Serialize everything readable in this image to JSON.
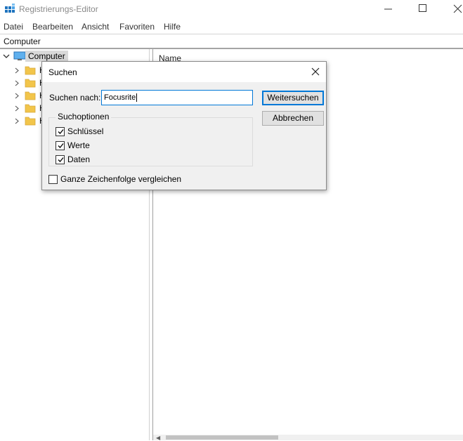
{
  "window": {
    "title": "Registrierungs-Editor",
    "controls": [
      "minimize-icon",
      "maximize-icon",
      "close-icon"
    ]
  },
  "menu": {
    "items": [
      "Datei",
      "Bearbeiten",
      "Ansicht",
      "Favoriten",
      "Hilfe"
    ]
  },
  "address": {
    "path": "Computer"
  },
  "tree": {
    "root_label": "Computer",
    "children": [
      {
        "label": "H",
        "icon": "folder-icon"
      },
      {
        "label": "H",
        "icon": "folder-icon"
      },
      {
        "label": "H",
        "icon": "folder-icon"
      },
      {
        "label": "H",
        "icon": "folder-icon"
      },
      {
        "label": "H",
        "icon": "folder-icon"
      }
    ]
  },
  "list": {
    "column_name": "Name"
  },
  "dialog": {
    "title": "Suchen",
    "find_label": "Suchen nach:",
    "find_value": "Focusrite",
    "find_next_button": "Weitersuchen",
    "cancel_button": "Abbrechen",
    "options_group": "Suchoptionen",
    "options": [
      {
        "label": "Schlüssel",
        "checked": true
      },
      {
        "label": "Werte",
        "checked": true
      },
      {
        "label": "Daten",
        "checked": true
      }
    ],
    "whole_string": {
      "label": "Ganze Zeichenfolge vergleichen",
      "checked": false
    }
  },
  "colors": {
    "accent": "#0078d7",
    "folder": "#f2c54a",
    "selection": "#d9d9d9",
    "dialog_bg": "#f0f0f0"
  }
}
